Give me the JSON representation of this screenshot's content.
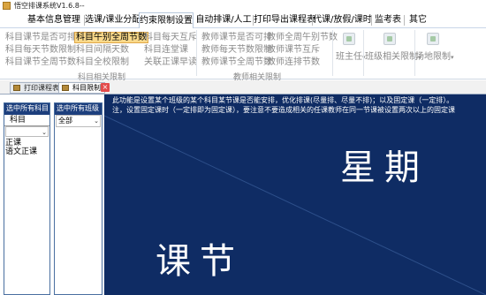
{
  "window": {
    "title": "悟空排课系统V1.6.8--"
  },
  "menu": {
    "items": [
      {
        "label": "基本信息管理"
      },
      {
        "label": "选课/课业分配"
      },
      {
        "label": "约束限制设置"
      },
      {
        "label": "自动排课/人工"
      },
      {
        "label": "打印导出课程表"
      },
      {
        "label": "代课/放假/课时"
      },
      {
        "label": "监考表"
      },
      {
        "label": "其它"
      }
    ]
  },
  "ribbon": {
    "subject_buttons": {
      "b1": "科目课节是否可排",
      "b2": "科目午别全周节数",
      "b3": "科目每天互斥",
      "b4": "科目每天节数限制",
      "b5": "科目间隔天数",
      "b6": "科目连堂课",
      "b7": "科目课节全周节数",
      "b8": "科目全校限制",
      "b9": "关联正课早读"
    },
    "subject_group_label": "科目相关限制",
    "teacher_buttons": {
      "b1": "教师课节是否可排",
      "b2": "教师全周午别节数",
      "b3": "教师每天节数限制",
      "b4": "教师课节互斥",
      "b5": "教师课节全周节数",
      "b6": "教师连排节数"
    },
    "teacher_group_label": "教师相关限制",
    "headteacher_label": "班主任",
    "class_label": "班级相关限制",
    "venue_label": "场地限制"
  },
  "doc_tabs": {
    "tab1": "打印课程表",
    "tab2": "科目限制",
    "close": "×"
  },
  "left_panel": {
    "header": "选中所有科目",
    "field": "科目",
    "items": {
      "i1": "正课",
      "i2": "语文正课"
    }
  },
  "middle_panel": {
    "header": "选中所有班级",
    "select_value": "全部"
  },
  "main": {
    "info_line1": "此功能是设置某个班级的某个科目某节课是否能安排，优化排课(尽量排、尽量不排)；以及固定课（一定排）。",
    "info_line2": "注，设置固定课时（一定排即为固定课），要注意不要造成相关的任课教师在同一节课被设置两次以上的固定课",
    "header_right": "星期",
    "header_left": "课节"
  },
  "colors": {
    "main_background": "#0f2c64",
    "selected_ribbon_button": "#f9d98a",
    "panel_header": "#1d3f7d"
  }
}
